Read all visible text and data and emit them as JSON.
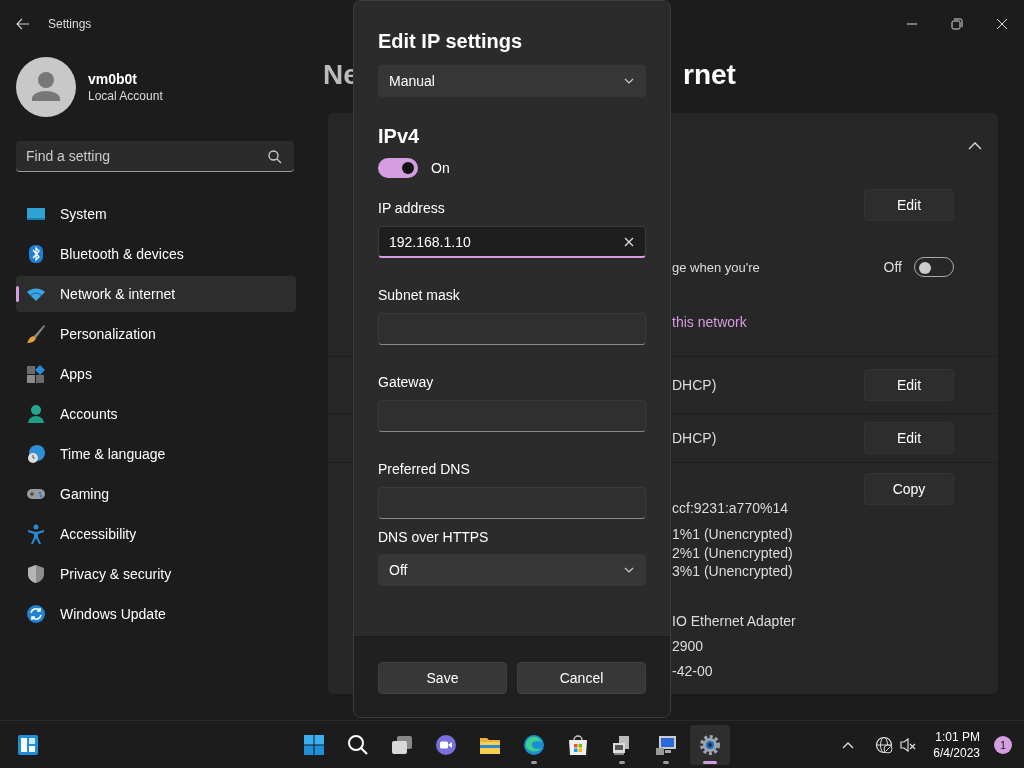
{
  "window": {
    "title": "Settings"
  },
  "account": {
    "name": "vm0b0t",
    "type": "Local Account"
  },
  "search": {
    "placeholder": "Find a setting"
  },
  "sidebar": {
    "items": [
      {
        "label": "System",
        "selected": false
      },
      {
        "label": "Bluetooth & devices",
        "selected": false
      },
      {
        "label": "Network & internet",
        "selected": true
      },
      {
        "label": "Personalization",
        "selected": false
      },
      {
        "label": "Apps",
        "selected": false
      },
      {
        "label": "Accounts",
        "selected": false
      },
      {
        "label": "Time & language",
        "selected": false
      },
      {
        "label": "Gaming",
        "selected": false
      },
      {
        "label": "Accessibility",
        "selected": false
      },
      {
        "label": "Privacy & security",
        "selected": false
      },
      {
        "label": "Windows Update",
        "selected": false
      }
    ]
  },
  "page": {
    "title_start": "Ne",
    "title_end": "rnet"
  },
  "card": {
    "expanded": true,
    "rows": [
      {
        "kind": "button",
        "button": "Edit"
      },
      {
        "kind": "toggle",
        "text": "ge when you're",
        "state_label": "Off",
        "on": false
      },
      {
        "kind": "link",
        "text": "this network"
      },
      {
        "kind": "button",
        "text": "DHCP)",
        "button": "Edit"
      },
      {
        "kind": "button",
        "text": "DHCP)",
        "button": "Edit"
      },
      {
        "kind": "copy",
        "text": "ccf:9231:a770%14",
        "button": "Copy"
      },
      {
        "kind": "list",
        "lines": [
          "1%1 (Unencrypted)",
          "2%1 (Unencrypted)",
          "3%1 (Unencrypted)"
        ]
      },
      {
        "kind": "details",
        "lines": [
          "IO Ethernet Adapter",
          "2900",
          "-42-00"
        ]
      }
    ]
  },
  "dialog": {
    "title": "Edit IP settings",
    "mode": "Manual",
    "section": "IPv4",
    "ipv4_toggle": {
      "on": true,
      "label": "On"
    },
    "fields": [
      {
        "label": "IP address",
        "value": "192.168.1.10",
        "focused": true
      },
      {
        "label": "Subnet mask",
        "focused": false
      },
      {
        "label": "Gateway",
        "focused": false
      },
      {
        "label": "Preferred DNS",
        "focused": false
      }
    ],
    "dns_over_https": {
      "label": "DNS over HTTPS",
      "value": "Off"
    },
    "buttons": [
      "Save",
      "Cancel"
    ]
  },
  "taskbar": {
    "apps": [
      {
        "running": false,
        "selected": false
      },
      {
        "running": false,
        "selected": false
      },
      {
        "running": false,
        "selected": false
      },
      {
        "running": false,
        "selected": false
      },
      {
        "running": false,
        "selected": false
      },
      {
        "running": true,
        "selected": false
      },
      {
        "running": false,
        "selected": false
      },
      {
        "running": true,
        "selected": false
      },
      {
        "running": true,
        "selected": false
      },
      {
        "running": true,
        "selected": true
      }
    ],
    "time": "1:01 PM",
    "date": "6/4/2023",
    "notifications": "1"
  }
}
